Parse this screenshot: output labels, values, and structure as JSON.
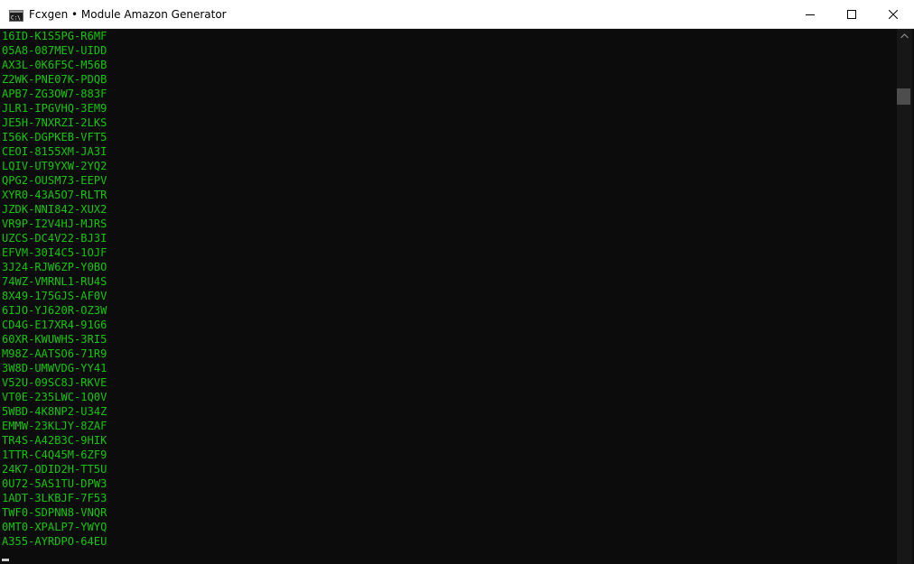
{
  "window": {
    "title": "Fcxgen • Module Amazon Generator",
    "icon": "console-app-icon",
    "controls": [
      "minimize-icon",
      "maximize-icon",
      "close-icon"
    ]
  },
  "colors": {
    "console_bg": "#0c0c0c",
    "text_green": "#16c60c",
    "scrollbar_thumb": "#4d4d4d"
  },
  "console": {
    "lines": [
      "16ID-K1S5PG-R6MF",
      "05A8-087MEV-UIDD",
      "AX3L-0K6F5C-M56B",
      "Z2WK-PNE07K-PDQB",
      "APB7-ZG3OW7-883F",
      "JLR1-IPGVHQ-3EM9",
      "JE5H-7NXRZI-2LKS",
      "I56K-DGPKEB-VFT5",
      "CEOI-8155XM-JA3I",
      "LQIV-UT9YXW-2YQ2",
      "QPG2-OUSM73-EEPV",
      "XYR0-43A5O7-RLTR",
      "JZDK-NNI842-XUX2",
      "VR9P-I2V4HJ-MJRS",
      "UZCS-DC4V22-BJ3I",
      "EFVM-30I4C5-1OJF",
      "3J24-RJW6ZP-Y0BO",
      "74WZ-VMRNL1-RU4S",
      "8X49-175GJS-AF0V",
      "6IJO-YJ620R-OZ3W",
      "CD4G-E17XR4-91G6",
      "60XR-KWUWHS-3RI5",
      "M98Z-AATSO6-71R9",
      "3W8D-UMWVDG-YY41",
      "V52U-09SC8J-RKVE",
      "VT0E-235LWC-1Q0V",
      "5WBD-4K8NP2-U34Z",
      "EMMW-23KLJY-8ZAF",
      "TR4S-A42B3C-9HIK",
      "1TTR-C4Q45M-6ZF9",
      "24K7-ODID2H-TT5U",
      "0U72-5AS1TU-DPW3",
      "1ADT-3LKBJF-7F53",
      "TWF0-SDPNN8-VNQR",
      "0MT0-XPALP7-YWYQ",
      "A355-AYRDPO-64EU"
    ]
  }
}
